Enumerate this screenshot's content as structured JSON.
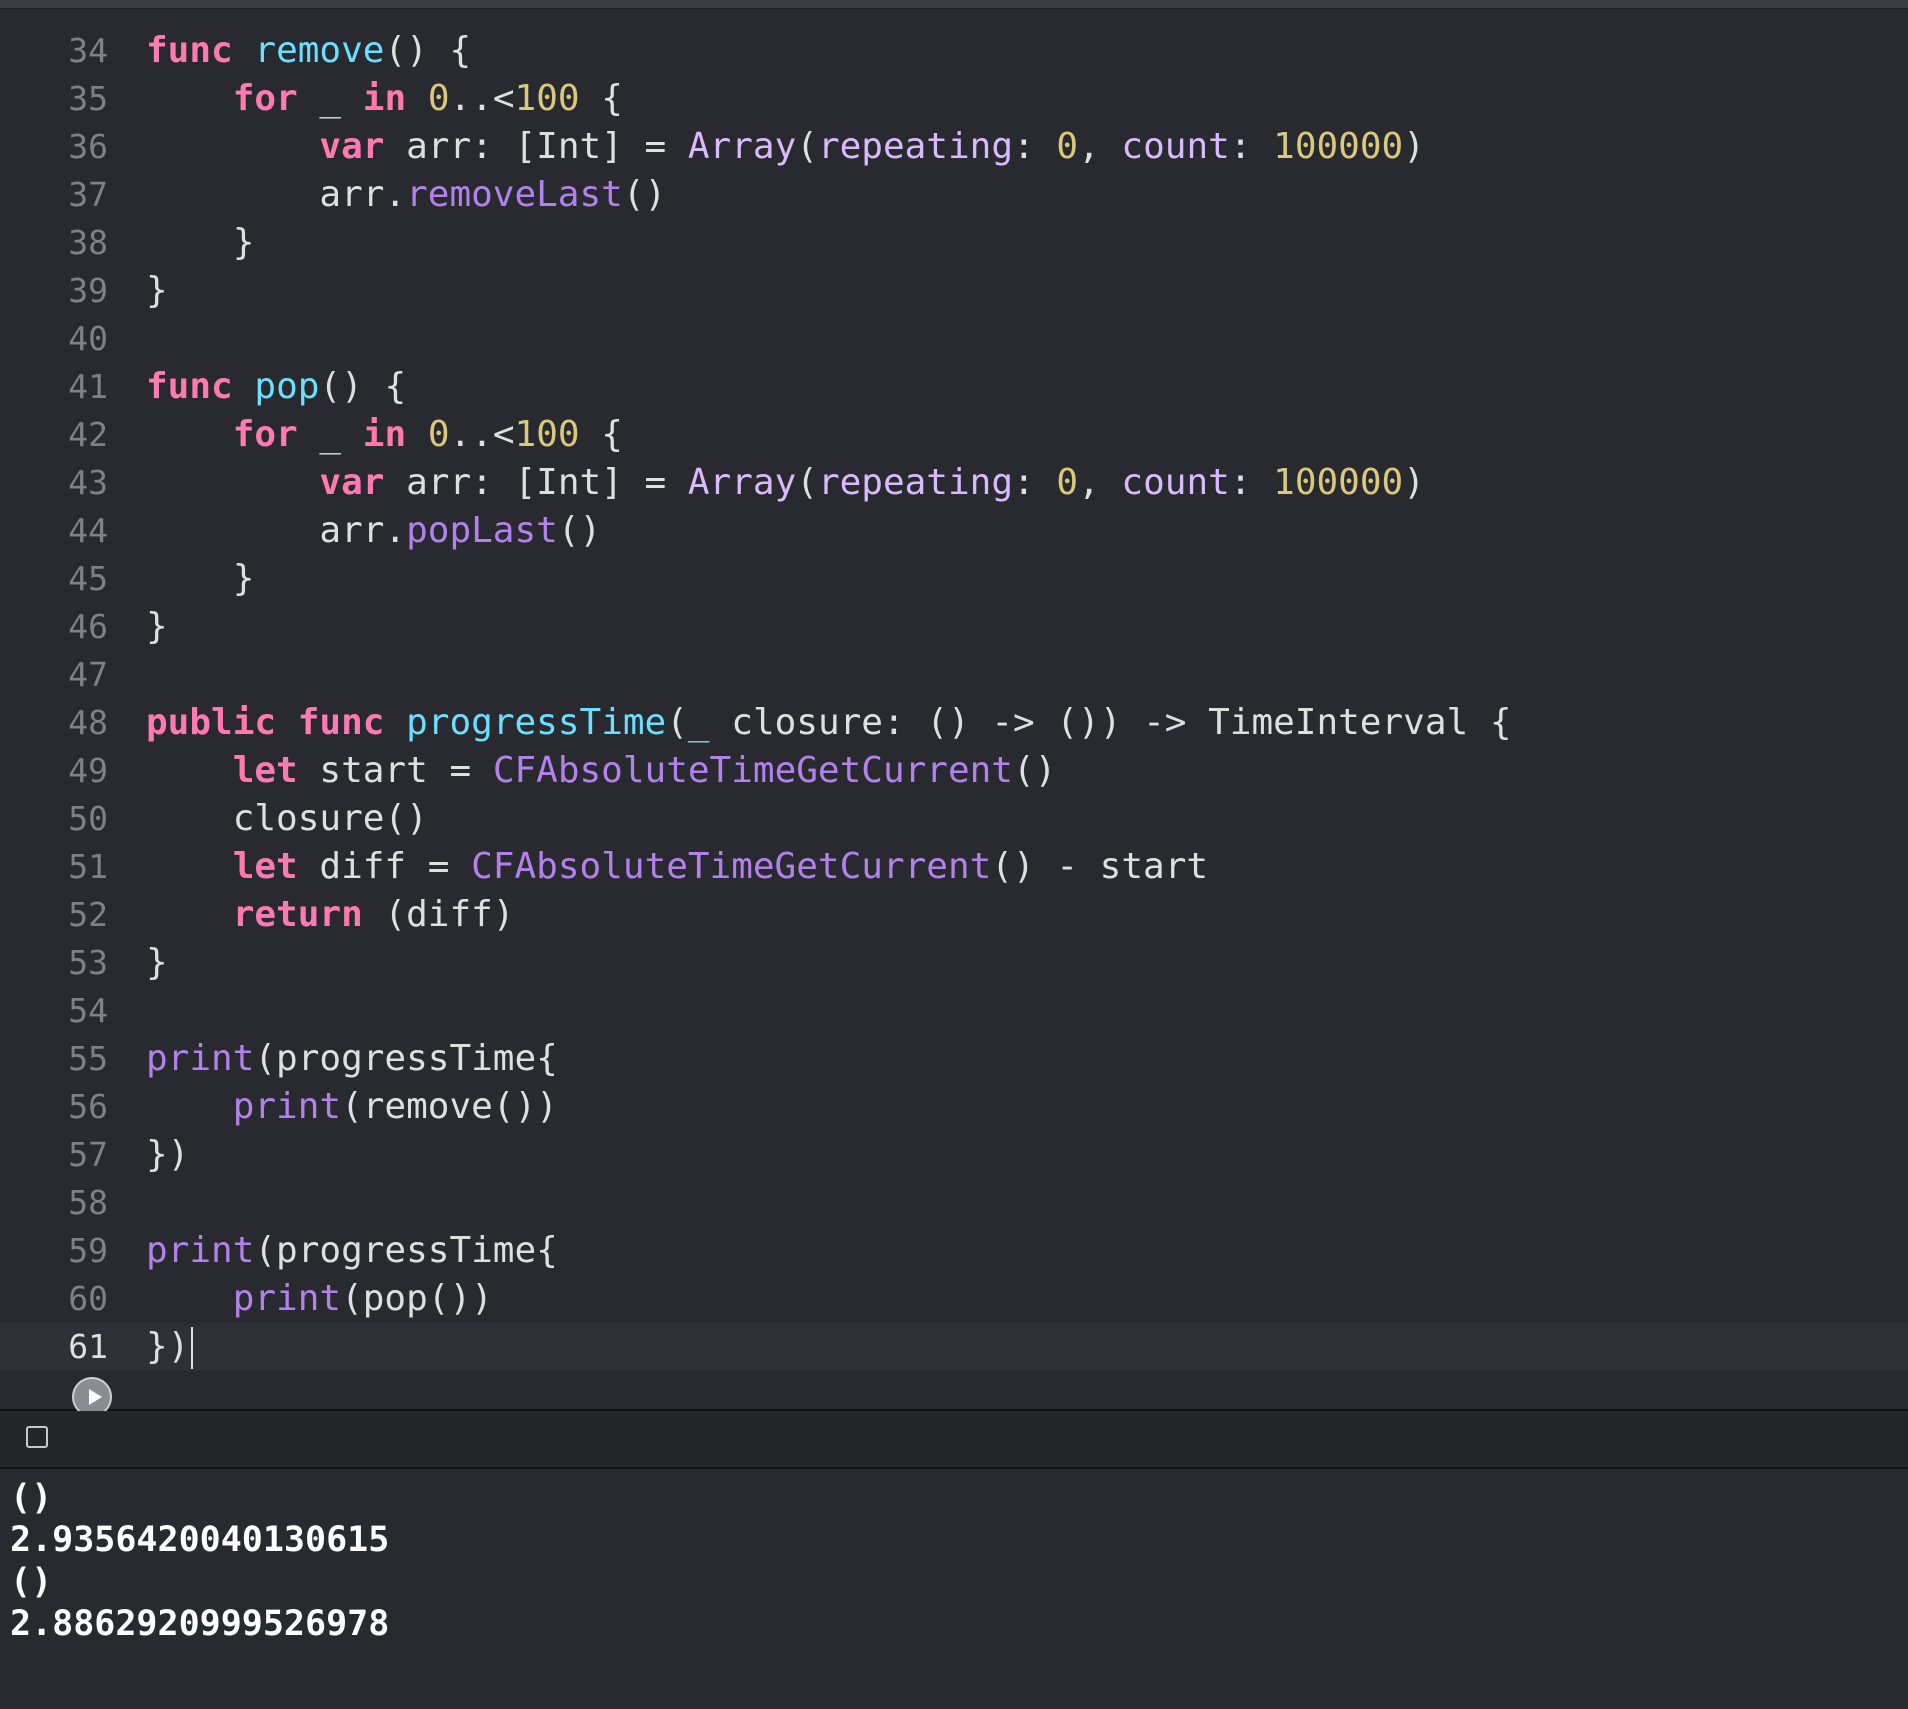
{
  "editor": {
    "current_line": 61,
    "lines": [
      {
        "n": 34,
        "tokens": [
          [
            "kw",
            "func"
          ],
          [
            "plain",
            " "
          ],
          [
            "decl",
            "remove"
          ],
          [
            "plain",
            "() {"
          ]
        ]
      },
      {
        "n": 35,
        "tokens": [
          [
            "plain",
            "    "
          ],
          [
            "kw",
            "for"
          ],
          [
            "plain",
            " _ "
          ],
          [
            "kw",
            "in"
          ],
          [
            "plain",
            " "
          ],
          [
            "num",
            "0"
          ],
          [
            "plain",
            "..<"
          ],
          [
            "num",
            "100"
          ],
          [
            "plain",
            " {"
          ]
        ]
      },
      {
        "n": 36,
        "tokens": [
          [
            "plain",
            "        "
          ],
          [
            "kw",
            "var"
          ],
          [
            "plain",
            " arr: ["
          ],
          [
            "plain",
            "Int"
          ],
          [
            "plain",
            "] = "
          ],
          [
            "type",
            "Array"
          ],
          [
            "plain",
            "("
          ],
          [
            "type",
            "repeating"
          ],
          [
            "plain",
            ": "
          ],
          [
            "num",
            "0"
          ],
          [
            "plain",
            ", "
          ],
          [
            "type",
            "count"
          ],
          [
            "plain",
            ": "
          ],
          [
            "num",
            "100000"
          ],
          [
            "plain",
            ")"
          ]
        ]
      },
      {
        "n": 37,
        "tokens": [
          [
            "plain",
            "        arr."
          ],
          [
            "func",
            "removeLast"
          ],
          [
            "plain",
            "()"
          ]
        ]
      },
      {
        "n": 38,
        "tokens": [
          [
            "plain",
            "    }"
          ]
        ]
      },
      {
        "n": 39,
        "tokens": [
          [
            "plain",
            "}"
          ]
        ]
      },
      {
        "n": 40,
        "tokens": []
      },
      {
        "n": 41,
        "tokens": [
          [
            "kw",
            "func"
          ],
          [
            "plain",
            " "
          ],
          [
            "decl",
            "pop"
          ],
          [
            "plain",
            "() {"
          ]
        ]
      },
      {
        "n": 42,
        "tokens": [
          [
            "plain",
            "    "
          ],
          [
            "kw",
            "for"
          ],
          [
            "plain",
            " _ "
          ],
          [
            "kw",
            "in"
          ],
          [
            "plain",
            " "
          ],
          [
            "num",
            "0"
          ],
          [
            "plain",
            "..<"
          ],
          [
            "num",
            "100"
          ],
          [
            "plain",
            " {"
          ]
        ]
      },
      {
        "n": 43,
        "tokens": [
          [
            "plain",
            "        "
          ],
          [
            "kw",
            "var"
          ],
          [
            "plain",
            " arr: ["
          ],
          [
            "plain",
            "Int"
          ],
          [
            "plain",
            "] = "
          ],
          [
            "type",
            "Array"
          ],
          [
            "plain",
            "("
          ],
          [
            "type",
            "repeating"
          ],
          [
            "plain",
            ": "
          ],
          [
            "num",
            "0"
          ],
          [
            "plain",
            ", "
          ],
          [
            "type",
            "count"
          ],
          [
            "plain",
            ": "
          ],
          [
            "num",
            "100000"
          ],
          [
            "plain",
            ")"
          ]
        ]
      },
      {
        "n": 44,
        "tokens": [
          [
            "plain",
            "        arr."
          ],
          [
            "func",
            "popLast"
          ],
          [
            "plain",
            "()"
          ]
        ]
      },
      {
        "n": 45,
        "tokens": [
          [
            "plain",
            "    }"
          ]
        ]
      },
      {
        "n": 46,
        "tokens": [
          [
            "plain",
            "}"
          ]
        ]
      },
      {
        "n": 47,
        "tokens": []
      },
      {
        "n": 48,
        "tokens": [
          [
            "kw",
            "public"
          ],
          [
            "plain",
            " "
          ],
          [
            "kw",
            "func"
          ],
          [
            "plain",
            " "
          ],
          [
            "decl",
            "progressTime"
          ],
          [
            "plain",
            "("
          ],
          [
            "decl",
            "_"
          ],
          [
            "plain",
            " closure: () -> ()) -> TimeInterval {"
          ]
        ]
      },
      {
        "n": 49,
        "tokens": [
          [
            "plain",
            "    "
          ],
          [
            "kw",
            "let"
          ],
          [
            "plain",
            " start = "
          ],
          [
            "func",
            "CFAbsoluteTimeGetCurrent"
          ],
          [
            "plain",
            "()"
          ]
        ]
      },
      {
        "n": 50,
        "tokens": [
          [
            "plain",
            "    closure()"
          ]
        ]
      },
      {
        "n": 51,
        "tokens": [
          [
            "plain",
            "    "
          ],
          [
            "kw",
            "let"
          ],
          [
            "plain",
            " diff = "
          ],
          [
            "func",
            "CFAbsoluteTimeGetCurrent"
          ],
          [
            "plain",
            "() - start"
          ]
        ]
      },
      {
        "n": 52,
        "tokens": [
          [
            "plain",
            "    "
          ],
          [
            "kw",
            "return"
          ],
          [
            "plain",
            " (diff)"
          ]
        ]
      },
      {
        "n": 53,
        "tokens": [
          [
            "plain",
            "}"
          ]
        ]
      },
      {
        "n": 54,
        "tokens": []
      },
      {
        "n": 55,
        "tokens": [
          [
            "func",
            "print"
          ],
          [
            "plain",
            "(progressTime{"
          ]
        ]
      },
      {
        "n": 56,
        "tokens": [
          [
            "plain",
            "    "
          ],
          [
            "func",
            "print"
          ],
          [
            "plain",
            "(remove())"
          ]
        ]
      },
      {
        "n": 57,
        "tokens": [
          [
            "plain",
            "})"
          ]
        ]
      },
      {
        "n": 58,
        "tokens": []
      },
      {
        "n": 59,
        "tokens": [
          [
            "func",
            "print"
          ],
          [
            "plain",
            "(progressTime{"
          ]
        ]
      },
      {
        "n": 60,
        "tokens": [
          [
            "plain",
            "    "
          ],
          [
            "func",
            "print"
          ],
          [
            "plain",
            "(pop())"
          ]
        ]
      },
      {
        "n": 61,
        "tokens": [
          [
            "plain",
            "})"
          ]
        ]
      }
    ]
  },
  "console": {
    "output": [
      "()",
      "2.9356420040130615",
      "()",
      "2.8862920999526978"
    ]
  },
  "colors": {
    "background": "#292a30",
    "keyword": "#ff7ab2",
    "declaration": "#6bdfff",
    "function": "#b281eb",
    "number": "#d9c97c",
    "type": "#dabaff",
    "plain": "#dfdfe0",
    "line_number": "#7f8088"
  },
  "icons": {
    "run": "play-circle-icon",
    "console_toggle": "checkbox-icon"
  }
}
